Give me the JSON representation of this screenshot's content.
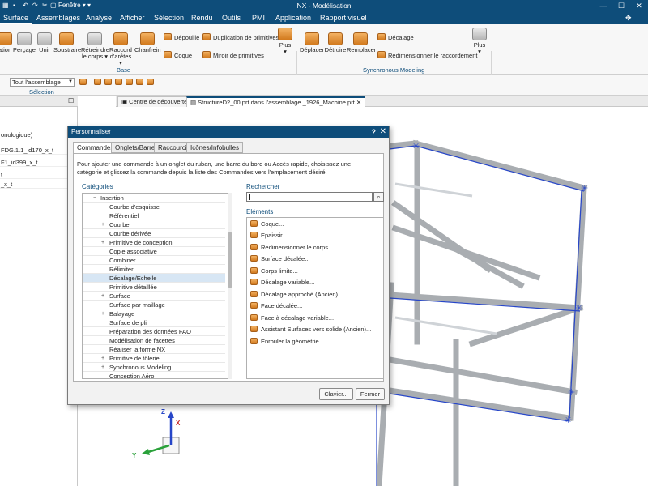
{
  "titlebar": {
    "title": "NX - Modélisation",
    "window_menu": "Fenêtre ▾ ▾"
  },
  "menubar": {
    "items": [
      "Surface",
      "Assemblages",
      "Analyse",
      "Afficher",
      "Sélection",
      "Rendu",
      "Outils",
      "PMI",
      "Application",
      "Rapport visuel"
    ],
    "active_index": 0
  },
  "ribbon": {
    "big_buttons": [
      {
        "label": "ation",
        "label2": ""
      },
      {
        "label": "Perçage",
        "label2": ""
      },
      {
        "label": "Unir",
        "label2": ""
      },
      {
        "label": "Soustraire",
        "label2": ""
      },
      {
        "label": "Rétreindre",
        "label2": "le corps ▾"
      },
      {
        "label": "Raccord",
        "label2": "d'arêtes ▾"
      },
      {
        "label": "Chanfrein",
        "label2": ""
      }
    ],
    "small_buttons": [
      "Dépouille",
      "Coque",
      "Duplication de primitives",
      "Miroir de primitives"
    ],
    "plus": "Plus",
    "group_base": "Base",
    "sync_buttons": [
      "Déplacer",
      "Détruire",
      "Remplacer"
    ],
    "sync_small": [
      "Décalage",
      "Redimensionner le raccordement"
    ],
    "group_sync": "Synchronous Modeling"
  },
  "toolbar": {
    "filter_value": "Tout l'assemblage",
    "group_selection": "Sélection"
  },
  "nav": {
    "rows": [
      "onologique)",
      "FDG.1.1_id170_x_t",
      "F1_id399_x_t",
      "t",
      "_x_t"
    ]
  },
  "tabs": [
    {
      "label": "Centre de découverte"
    },
    {
      "label": "StructureD2_00.prt dans l'assemblage _1926_Machine.prt ✕"
    }
  ],
  "dialog": {
    "title": "Personnaliser",
    "tabs": [
      "Commandes",
      "Onglets/Barres",
      "Raccourcis",
      "Icônes/Infobulles"
    ],
    "description": "Pour ajouter une commande à un onglet du ruban, une barre du bord ou Accès rapide, choisissez une catégorie et glissez la commande depuis la liste des Commandes vers l'emplacement désiré.",
    "categories_label": "Catégories",
    "search_label": "Rechercher",
    "elements_label": "Eléments",
    "categories": [
      {
        "label": "Insertion",
        "expander": "−"
      },
      {
        "label": "Courbe d'esquisse",
        "expander": ""
      },
      {
        "label": "Référentiel",
        "expander": ""
      },
      {
        "label": "Courbe",
        "expander": "+"
      },
      {
        "label": "Courbe dérivée",
        "expander": ""
      },
      {
        "label": "Primitive de conception",
        "expander": "+"
      },
      {
        "label": "Copie associative",
        "expander": ""
      },
      {
        "label": "Combiner",
        "expander": ""
      },
      {
        "label": "Rélimiter",
        "expander": ""
      },
      {
        "label": "Décalage/Echelle",
        "expander": ""
      },
      {
        "label": "Primitive détaillée",
        "expander": ""
      },
      {
        "label": "Surface",
        "expander": "+"
      },
      {
        "label": "Surface par maillage",
        "expander": ""
      },
      {
        "label": "Balayage",
        "expander": "+"
      },
      {
        "label": "Surface de pli",
        "expander": ""
      },
      {
        "label": "Préparation des données FAO",
        "expander": ""
      },
      {
        "label": "Modélisation de facettes",
        "expander": ""
      },
      {
        "label": "Réaliser la forme NX",
        "expander": ""
      },
      {
        "label": "Primitive de tôlerie",
        "expander": "+"
      },
      {
        "label": "Synchronous Modeling",
        "expander": "+"
      },
      {
        "label": "Conception Aéro",
        "expander": ""
      }
    ],
    "selected_category_index": 9,
    "elements": [
      "Coque...",
      "Epaissir...",
      "Redimensionner le corps...",
      "Surface décalée...",
      "Corps limite...",
      "Décalage variable...",
      "Décalage approché (Ancien)...",
      "Face décalée...",
      "Face à décalage variable...",
      "Assistant Surfaces vers solide (Ancien)...",
      "Enrouler la géométrie..."
    ],
    "buttons": {
      "keyboard": "Clavier...",
      "close": "Fermer"
    }
  },
  "triad": {
    "x": "X",
    "y": "Y",
    "z": "Z"
  },
  "colors": {
    "accent": "#0e4d7a",
    "frame": "#a9adb1",
    "edge_highlight": "#2746c8"
  }
}
